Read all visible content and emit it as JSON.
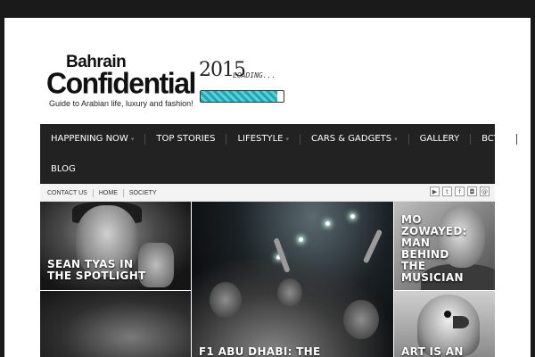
{
  "header": {
    "logo_line1": "Bahrain",
    "logo_line2": "Confidential",
    "logo_tagline": "Guide to Arabian life, luxury and fashion!",
    "banner_year": "2015",
    "banner_text": "LOADING...",
    "banner_progress": 0.93
  },
  "nav": {
    "items": [
      {
        "label": "HAPPENING NOW",
        "dropdown": true
      },
      {
        "label": "TOP STORIES",
        "dropdown": false
      },
      {
        "label": "LIFESTYLE",
        "dropdown": true
      },
      {
        "label": "CARS & GADGETS",
        "dropdown": true
      },
      {
        "label": "GALLERY",
        "dropdown": false
      },
      {
        "label": "BCTV",
        "dropdown": false
      },
      {
        "label": "BLOG",
        "dropdown": false
      }
    ],
    "caret": "▾"
  },
  "topbar": {
    "links": [
      "CONTACT US",
      "HOME",
      "SOCIETY"
    ],
    "social": [
      {
        "icon": "youtube-icon",
        "glyph": "▶"
      },
      {
        "icon": "twitter-icon",
        "glyph": "t"
      },
      {
        "icon": "facebook-icon",
        "glyph": "f"
      },
      {
        "icon": "instagram-icon",
        "glyph": "◘"
      },
      {
        "icon": "email-icon",
        "glyph": "@"
      }
    ]
  },
  "tiles": [
    {
      "caption": "SEAN TYAS IN THE SPOTLIGHT"
    },
    {
      "caption": "F1 ABU DHABI: THE"
    },
    {
      "caption": "MO ZOWAYED: MAN BEHIND THE MUSICIAN"
    },
    {
      "caption": ""
    },
    {
      "caption": "ART IS AN"
    }
  ],
  "colors": {
    "nav_bg": "#222222",
    "page_bg": "#1a1a1a",
    "banner_accent": "#1aa9b6"
  }
}
